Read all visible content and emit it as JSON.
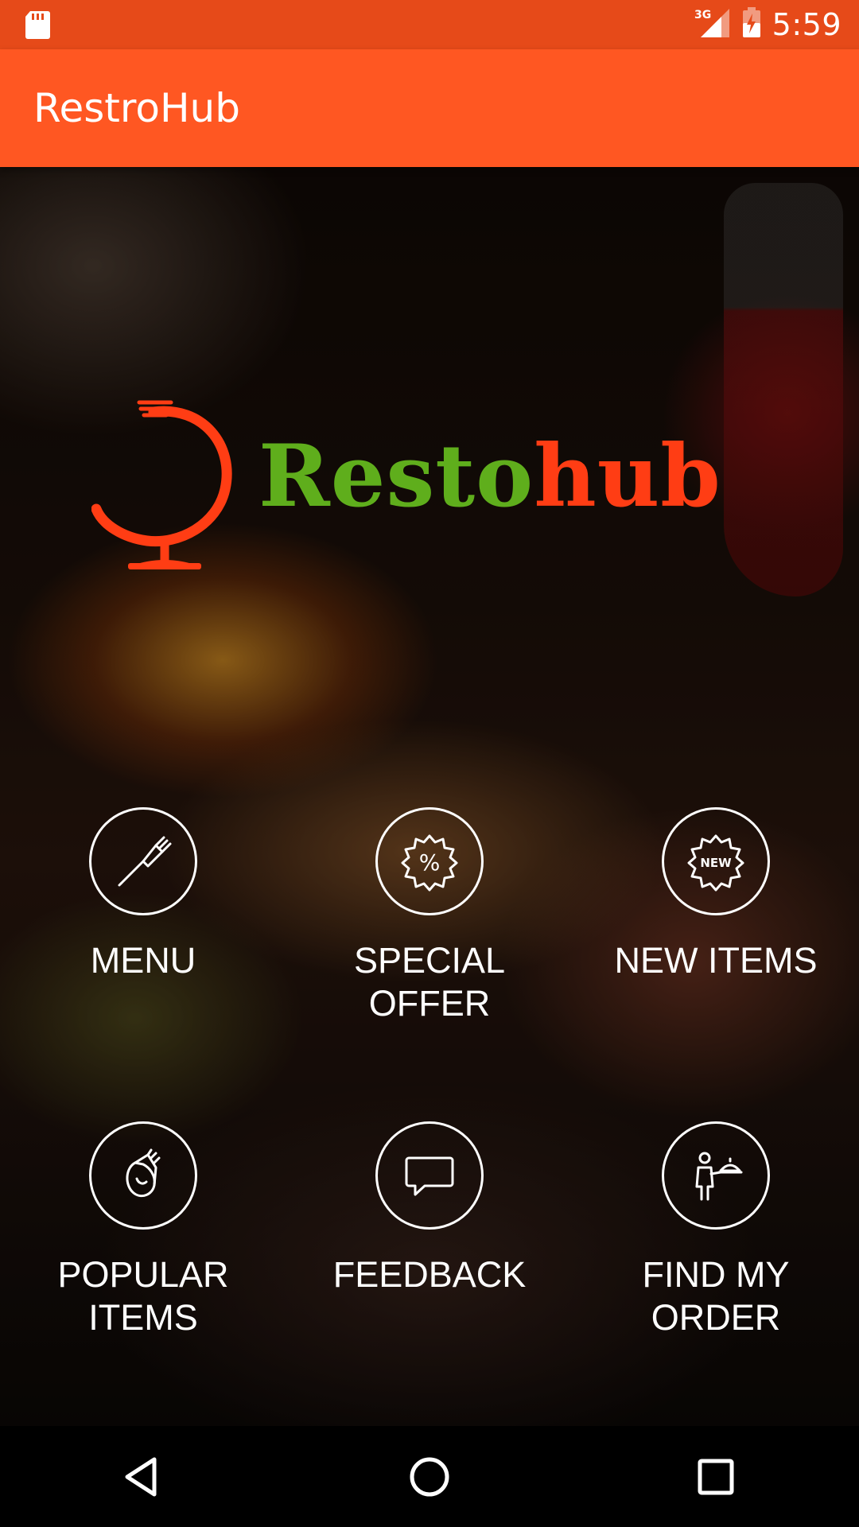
{
  "status_bar": {
    "network_label": "3G",
    "time": "5:59",
    "icons": [
      "sd-card-icon",
      "signal-icon",
      "battery-charging-icon"
    ]
  },
  "app_bar": {
    "title": "RestroHub"
  },
  "logo": {
    "text_part1": "Resto",
    "text_part2": "hub",
    "colors": {
      "green": "#5FAE1C",
      "orange": "#FF3D14"
    }
  },
  "grid": {
    "items": [
      {
        "label": "MENU",
        "icon": "fork-icon"
      },
      {
        "label": "SPECIAL OFFER",
        "icon": "percent-badge-icon"
      },
      {
        "label": "NEW ITEMS",
        "icon": "new-badge-icon",
        "badge_text": "NEW"
      },
      {
        "label": "POPULAR ITEMS",
        "icon": "popular-food-icon"
      },
      {
        "label": "FEEDBACK",
        "icon": "chat-bubble-icon"
      },
      {
        "label": "FIND MY ORDER",
        "icon": "waiter-icon"
      }
    ]
  },
  "nav_bar": {
    "buttons": [
      "back-icon",
      "home-icon",
      "recents-icon"
    ]
  },
  "colors": {
    "status_bar": "#E64A19",
    "app_bar": "#FF5722"
  }
}
